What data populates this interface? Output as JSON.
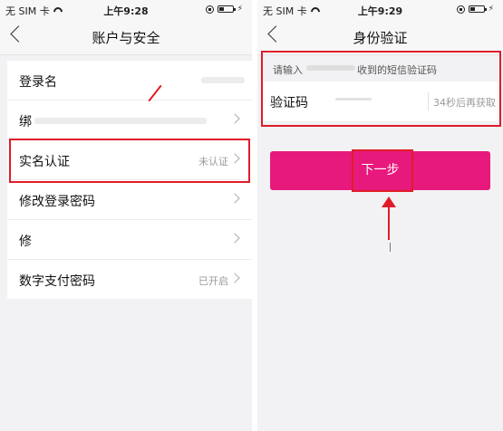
{
  "status_left": {
    "carrier": "无 SIM 卡",
    "time": "上午9:28"
  },
  "status_right": {
    "carrier": "无 SIM 卡",
    "time": "上午9:29"
  },
  "account_screen": {
    "title": "账户与安全",
    "rows": [
      {
        "label": "登录名",
        "value": ""
      },
      {
        "label": "绑",
        "value": ""
      },
      {
        "label": "实名认证",
        "value": "未认证"
      },
      {
        "label": "修改登录密码",
        "value": ""
      },
      {
        "label": "修",
        "value": ""
      },
      {
        "label": "数字支付密码",
        "value": "已开启"
      }
    ]
  },
  "verify_screen": {
    "title": "身份验证",
    "hint_prefix": "请输入",
    "hint_suffix": "收到的短信验证码",
    "code_label": "验证码",
    "countdown": "34秒后再获取",
    "next_button": "下一步"
  },
  "colors": {
    "highlight": "#e01c2a",
    "button": "#e8197c"
  }
}
